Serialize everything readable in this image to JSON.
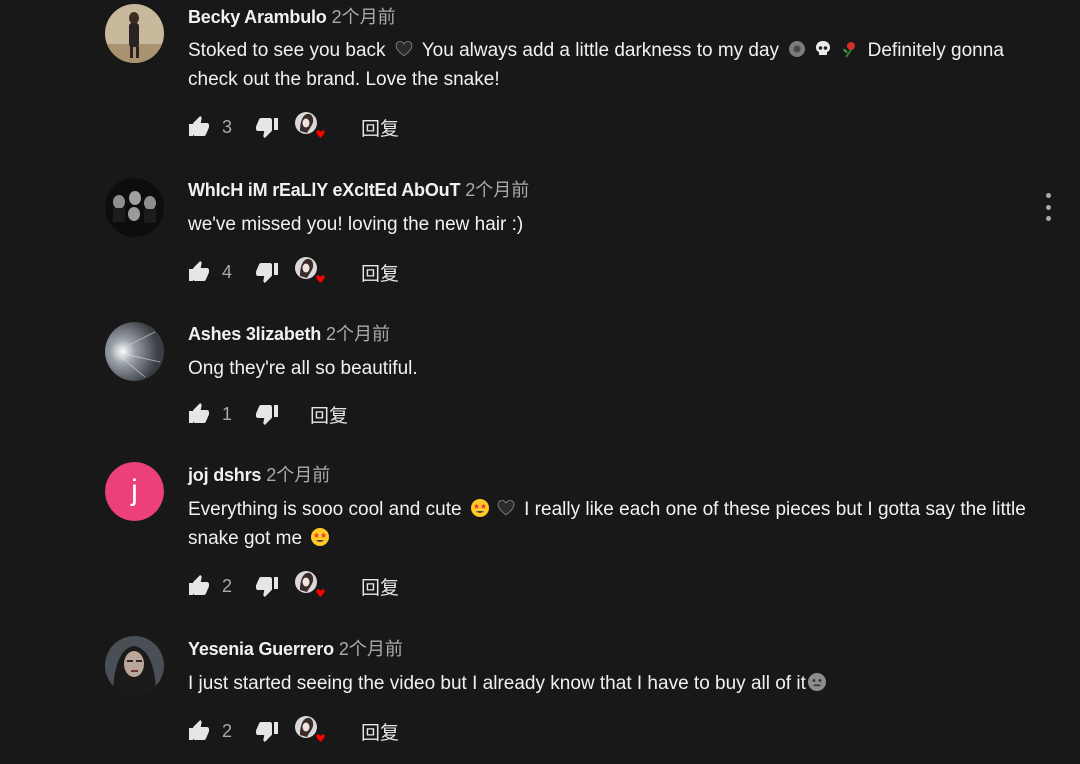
{
  "comments": [
    {
      "author": "Becky Arambulo",
      "time": "2个月前",
      "text_parts": [
        "Stoked to see you back",
        "You always add a little darkness to my day",
        "Definitely gonna check out the brand. Love the snake!"
      ],
      "likes": "3",
      "reply_label": "回复"
    },
    {
      "author": "WhIcH iM rEaLlY eXcItEd AbOuT",
      "time": "2个月前",
      "text": "we've missed you! loving the new hair :)",
      "likes": "4",
      "reply_label": "回复"
    },
    {
      "author": "Ashes 3lizabeth",
      "time": "2个月前",
      "text": "Ong they're all so beautiful.",
      "likes": "1",
      "reply_label": "回复"
    },
    {
      "author": "joj dshrs",
      "time": "2个月前",
      "avatar_initial": "j",
      "text_parts": [
        "Everything is sooo cool and cute",
        "I really like each one of these pieces but I gotta say the little snake got me"
      ],
      "likes": "2",
      "reply_label": "回复"
    },
    {
      "author": "Yesenia Guerrero",
      "time": "2个月前",
      "text": "I just started seeing the video but I already know that I have to buy all of it",
      "likes": "2",
      "reply_label": "回复"
    }
  ],
  "icons": {
    "like": "thumb-up-icon",
    "dislike": "thumb-down-icon",
    "creator_heart": "creator-heart-icon",
    "more": "more-vert-icon"
  },
  "colors": {
    "background": "#181818",
    "text": "#f1f1f1",
    "secondary_text": "#aaaaaa",
    "heart": "#ff0000",
    "avatar_j": "#ec407a"
  }
}
